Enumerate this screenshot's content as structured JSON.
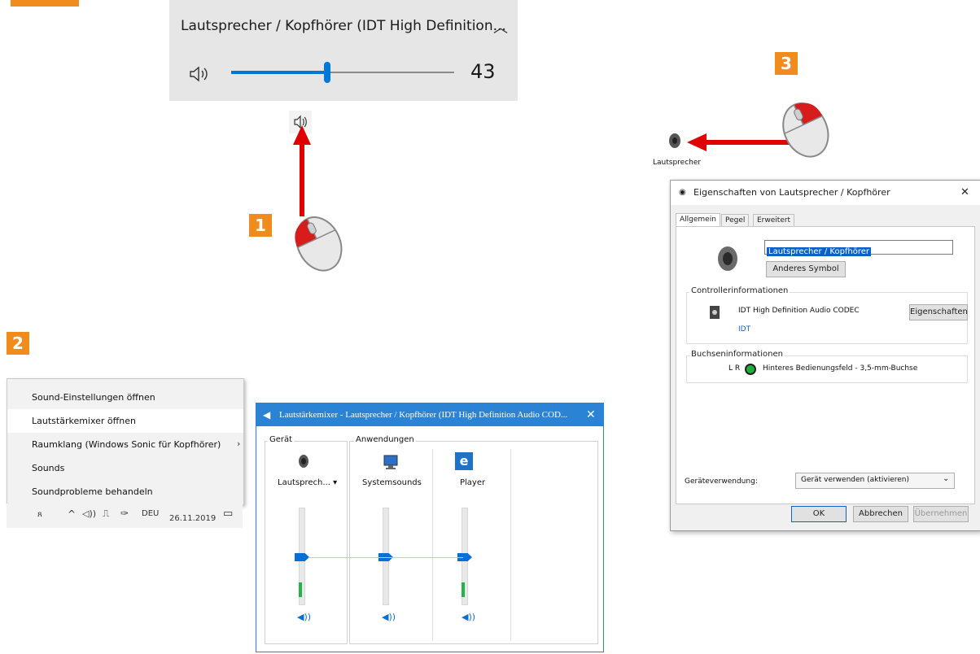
{
  "badges": {
    "b1": "1",
    "b2": "2",
    "b3": "3"
  },
  "volume_flyout": {
    "device_title": "Lautsprecher / Kopfhörer (IDT High Definition...",
    "volume_value": "43",
    "volume_level": 43
  },
  "context_menu": {
    "items": [
      {
        "label": "Sound-Einstellungen öffnen"
      },
      {
        "label": "Lautstärkemixer öffnen"
      },
      {
        "label": "Raumklang (Windows Sonic für Kopfhörer)"
      },
      {
        "label": "Sounds"
      },
      {
        "label": "Soundprobleme behandeln"
      }
    ]
  },
  "taskbar": {
    "lang": "DEU",
    "date": "26.11.2019"
  },
  "mixer": {
    "title": "Lautstärkemixer - Lautsprecher / Kopfhörer (IDT High Definition Audio COD...",
    "close": "✕",
    "device_group": "Gerät",
    "apps_group": "Anwendungen",
    "channels": [
      {
        "label": "Lautsprech... ▾"
      },
      {
        "label": "Systemsounds"
      },
      {
        "label": "Player"
      }
    ]
  },
  "speaker_label": "Lautsprecher",
  "properties": {
    "title": "Eigenschaften von Lautsprecher / Kopfhörer",
    "close": "✕",
    "tabs": [
      "Allgemein",
      "Pegel",
      "Erweitert"
    ],
    "device_name": "Lautsprecher / Kopfhörer",
    "change_icon": "Anderes Symbol",
    "controller_header": "Controllerinformationen",
    "controller_name": "IDT High Definition Audio CODEC",
    "controller_vendor": "IDT",
    "properties_button": "Eigenschaften",
    "jack_header": "Buchseninformationen",
    "jack_lr": "L R",
    "jack_desc": "Hinteres Bedienungsfeld - 3,5-mm-Buchse",
    "usage_label": "Geräteverwendung:",
    "usage_value": "Gerät verwenden (aktivieren)",
    "ok": "OK",
    "cancel": "Abbrechen",
    "apply": "Übernehmen"
  },
  "colors": {
    "accent": "#0078d7",
    "badge": "#f08c1e",
    "arrow": "#e00000"
  }
}
